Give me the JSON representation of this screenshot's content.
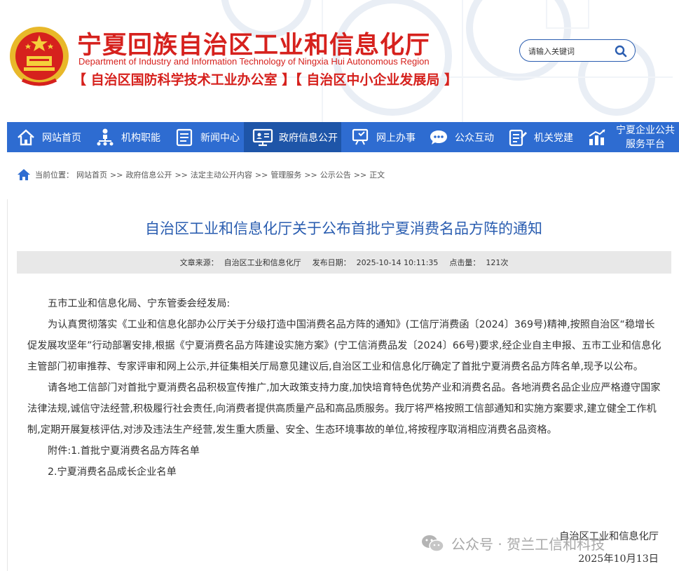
{
  "header": {
    "title": "宁夏回族自治区工业和信息化厅",
    "subtitle": "Department of Industry and Information Technology of Ningxia Hui Autonomous Region",
    "offices": "【 自治区国防科学技术工业办公室 】【 自治区中小企业发展局 】",
    "search_placeholder": "请输入关键词",
    "brand_color": "#d6211d"
  },
  "nav": {
    "items": [
      {
        "label": "网站首页",
        "icon": "home-icon"
      },
      {
        "label": "机构职能",
        "icon": "org-icon"
      },
      {
        "label": "新闻中心",
        "icon": "news-icon"
      },
      {
        "label": "政府信息公开",
        "icon": "monitor-icon",
        "active": true
      },
      {
        "label": "网上办事",
        "icon": "service-icon"
      },
      {
        "label": "公众互动",
        "icon": "chat-icon"
      },
      {
        "label": "机关党建",
        "icon": "party-icon"
      },
      {
        "label": "宁夏企业公共服务平台",
        "icon": "chart-icon"
      }
    ],
    "bg_color": "#2e6cd1",
    "active_color": "#1e55a8"
  },
  "breadcrumb": {
    "prefix": "当前位置：",
    "items": [
      "网站首页",
      "政府信息公开",
      "法定主动公开内容",
      "管理服务",
      "公示公告",
      "正文"
    ],
    "separator": ">>"
  },
  "article": {
    "title": "自治区工业和信息化厅关于公布首批宁夏消费名品方阵的通知",
    "source_label": "文章来源：",
    "source": "自治区工业和信息化厅",
    "date_label": "发布日期：",
    "date": "2025-10-14 10:11:35",
    "hits_label": "点击量：",
    "hits": "121次",
    "paragraphs": [
      "五市工业和信息化局、宁东管委会经发局:",
      "为认真贯彻落实《工业和信息化部办公厅关于分级打造中国消费名品方阵的通知》(工信厅消费函〔2024〕369号)精神,按照自治区“稳增长促发展攻坚年”行动部署安排,根据《宁夏消费名品方阵建设实施方案》(宁工信消费品发〔2024〕66号)要求,经企业自主申报、五市工业和信息化主管部门初审推荐、专家评审和网上公示,并征集相关厅局意见建议后,自治区工业和信息化厅确定了首批宁夏消费名品方阵名单,现予以公布。",
      "请各地工信部门对首批宁夏消费名品积极宣传推广,加大政策支持力度,加快培育特色优势产业和消费名品。各地消费名品企业应严格遵守国家法律法规,诚信守法经营,积极履行社会责任,向消费者提供高质量产品和高品质服务。我厅将严格按照工信部通知和实施方案要求,建立健全工作机制,定期开展复核评估,对涉及违法生产经营,发生重大质量、安全、生态环境事故的单位,将按程序取消相应消费名品资格。",
      "附件:1.首批宁夏消费名品方阵名单",
      "2.宁夏消费名品成长企业名单"
    ],
    "signature_org": "自治区工业和信息化厅",
    "signature_date": "2025年10月13日"
  },
  "watermark": {
    "text": "公众号 · 贺兰工信和科技"
  }
}
